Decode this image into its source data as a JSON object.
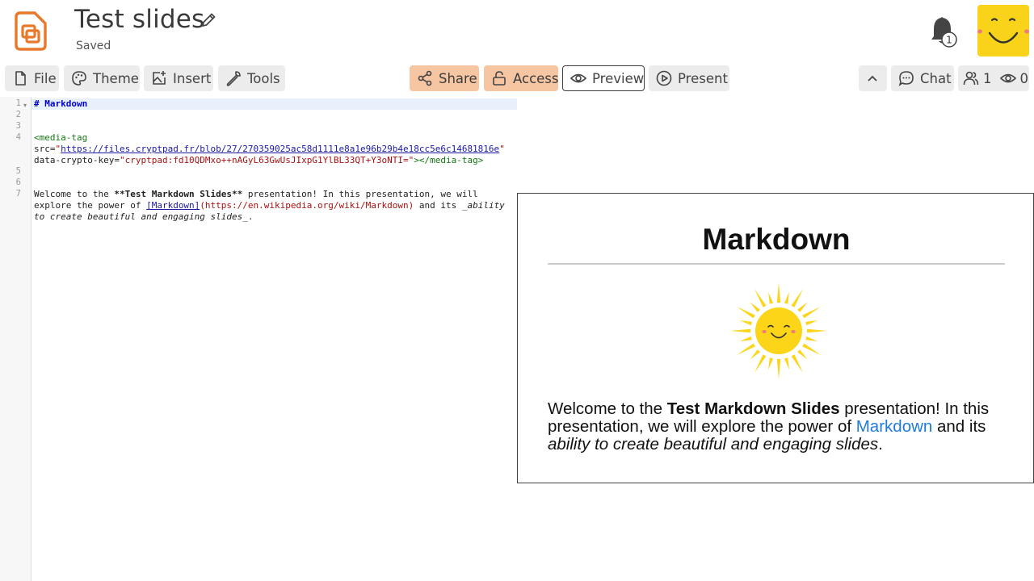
{
  "header": {
    "title": "Test slides",
    "status": "Saved",
    "notification_count": "1",
    "app_icon": "cryptpad-slides-icon",
    "avatar_icon": "smiley-avatar"
  },
  "toolbar": {
    "file": "File",
    "theme": "Theme",
    "insert": "Insert",
    "tools": "Tools",
    "share": "Share",
    "access": "Access",
    "preview": "Preview",
    "present": "Present",
    "chat": "Chat",
    "users_count": "1",
    "viewers_count": "0"
  },
  "colors": {
    "accent": "#f6c5a2",
    "brand_orange": "#e8792b",
    "link": "#1e7bdb",
    "avatar_yellow": "#f8d31a"
  },
  "editor": {
    "line_numbers": [
      "1",
      "2",
      "3",
      "4",
      "5",
      "6",
      "7"
    ],
    "line1": "# Markdown",
    "line4_a_tag": "<media-tag",
    "line4_b_attr": "src=",
    "line4_b_q1": "\"",
    "line4_b_url": "https://files.cryptpad.fr/blob/27/270359025ac58d1111e8a1e96b29b4e18cc5e6c14681816e",
    "line4_b_q2": "\"",
    "line4_c_attr": "data-crypto-key=",
    "line4_c_val": "\"cryptpad:fd10QDMxo++nAGyL63GwUsJIxpG1YlBL33QT+Y3oNTI=\"",
    "line4_c_close": "></media-tag>",
    "line7_a1": "Welcome to the ",
    "line7_a2": "**Test Markdown Slides**",
    "line7_a3": " presentation! In this presentation, we will",
    "line7_b1": "explore the power of ",
    "line7_b2": "[Markdown]",
    "line7_b3": "(https://en.wikipedia.org/wiki/Markdown)",
    "line7_b4": " and its ",
    "line7_b5": "_ability",
    "line7_c1": "to create beautiful and engaging slides_",
    "line7_c2": "."
  },
  "slide": {
    "heading": "Markdown",
    "image": "smiling-sun",
    "text_pre": "Welcome to the ",
    "text_bold": "Test Markdown Slides",
    "text_mid": " presentation! In this presentation, we will explore the power of ",
    "text_link": "Markdown",
    "text_post": " and its ",
    "text_italic": "ability to create beautiful and engaging slides",
    "text_end": "."
  }
}
